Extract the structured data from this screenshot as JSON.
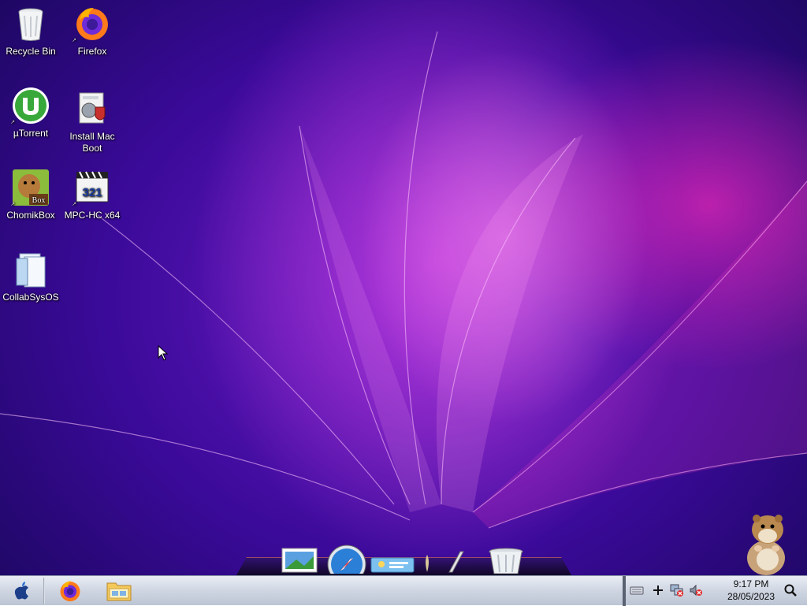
{
  "desktop": {
    "icons": [
      {
        "label": "Recycle Bin",
        "icon": "recycle-bin-icon"
      },
      {
        "label": "Firefox",
        "icon": "firefox-icon"
      },
      {
        "label": "µTorrent",
        "icon": "utorrent-icon"
      },
      {
        "label": "Install Mac Boot",
        "icon": "installer-icon"
      },
      {
        "label": "ChomikBox",
        "icon": "chomikbox-icon"
      },
      {
        "label": "MPC-HC x64",
        "icon": "mpc-hc-icon"
      },
      {
        "label": "CollabSysOS",
        "icon": "folder-icon"
      }
    ]
  },
  "dock": {
    "items": [
      "photos-icon",
      "safari-icon",
      "ichat-icon",
      "preferences-icon",
      "pen-icon",
      "trash-icon"
    ]
  },
  "taskbar": {
    "start_icon": "apple-icon",
    "pinned": [
      "firefox-icon",
      "file-explorer-icon"
    ],
    "tray": [
      "keyboard-icon",
      "plus-icon",
      "network-error-icon",
      "volume-muted-icon",
      "search-icon"
    ],
    "clock_time": "9:17 PM",
    "clock_date": "28/05/2023"
  },
  "colors": {
    "wallpaper_base": "#3b0a9a",
    "wallpaper_accent": "#e628b4",
    "taskbar_bg": "#cfd6e2"
  }
}
